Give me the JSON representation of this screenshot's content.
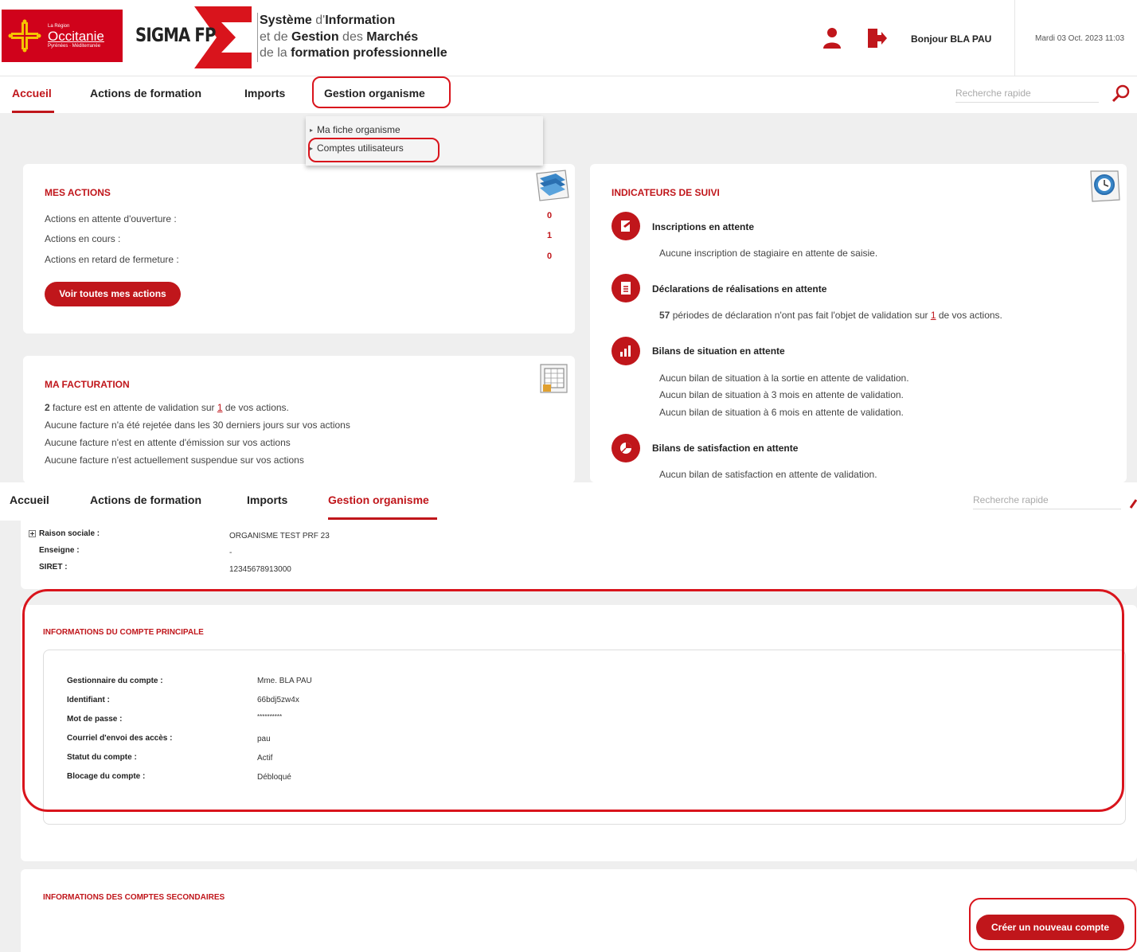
{
  "header": {
    "region_logo": {
      "small_top": "La Région",
      "name": "Occitanie",
      "small_bottom": "Pyrénées · Méditerranée"
    },
    "app_logo": "SIGMA FP",
    "title_lines": [
      {
        "a": "Système",
        "b": " d'",
        "c": "Information"
      },
      {
        "a": "et de ",
        "b": "Gestion",
        "c": " des ",
        "d": "Marchés"
      },
      {
        "a": "de la ",
        "b": "formation professionnelle"
      }
    ],
    "greeting": "Bonjour BLA PAU",
    "date": "Mardi 03 Oct. 2023 11:03",
    "user_icon": "user-icon",
    "logout_icon": "logout-icon"
  },
  "nav": {
    "items": [
      "Accueil",
      "Actions de formation",
      "Imports",
      "Gestion organisme"
    ],
    "search_placeholder": "Recherche rapide",
    "search_icon": "search-icon"
  },
  "dropdown": {
    "items": [
      "Ma fiche organisme",
      "Comptes utilisateurs"
    ]
  },
  "mes_actions": {
    "title": "MES ACTIONS",
    "rows": [
      {
        "label": "Actions en attente d'ouverture :",
        "value": "0"
      },
      {
        "label": "Actions en cours :",
        "value": "1"
      },
      {
        "label": "Actions en retard de fermeture :",
        "value": "0"
      }
    ],
    "button": "Voir toutes mes actions"
  },
  "facturation": {
    "title": "MA FACTURATION",
    "line1_count": "2",
    "line1_mid": " facture est en attente de validation sur ",
    "line1_link": "1",
    "line1_end": " de vos actions.",
    "lines": [
      "Aucune facture n'a été rejetée dans les 30 derniers jours sur vos actions",
      "Aucune facture n'est en attente d'émission sur vos actions",
      "Aucune facture n'est actuellement suspendue sur vos actions"
    ]
  },
  "indicateurs": {
    "title": "INDICATEURS DE SUIVI",
    "inscriptions": {
      "head": "Inscriptions en attente",
      "text": "Aucune inscription de stagiaire en attente de saisie."
    },
    "declarations": {
      "head": "Déclarations de réalisations en attente",
      "count": "57",
      "mid": " périodes de déclaration n'ont pas fait l'objet de validation sur ",
      "link": "1",
      "end": " de vos actions."
    },
    "bilans": {
      "head": "Bilans de situation en attente",
      "lines": [
        "Aucun bilan de situation à la sortie en attente de validation.",
        "Aucun bilan de situation à 3 mois en attente de validation.",
        "Aucun bilan de situation à 6 mois en attente de validation."
      ]
    },
    "satisfaction": {
      "head": "Bilans de satisfaction en attente",
      "text": "Aucun bilan de satisfaction en attente de validation."
    }
  },
  "organisme": {
    "expand_icon": "plus-box-icon",
    "raison_label": "Raison sociale :",
    "raison_value": "ORGANISME TEST PRF 23",
    "enseigne_label": "Enseigne :",
    "enseigne_value": "-",
    "siret_label": "SIRET :",
    "siret_value": "12345678913000"
  },
  "compte_principal": {
    "title": "INFORMATIONS DU COMPTE PRINCIPALE",
    "fields": [
      {
        "label": "Gestionnaire du compte :",
        "value": "Mme. BLA PAU"
      },
      {
        "label": "Identifiant :",
        "value": "66bdj5zw4x"
      },
      {
        "label": "Mot de passe :",
        "value": "**********"
      },
      {
        "label": "Courriel d'envoi des accès :",
        "value": "pau"
      },
      {
        "label": "Statut du compte :",
        "value": "Actif"
      },
      {
        "label": "Blocage du compte :",
        "value": "Débloqué"
      }
    ]
  },
  "comptes_secondaires": {
    "title": "INFORMATIONS DES COMPTES SECONDAIRES",
    "button": "Créer un nouveau compte"
  },
  "colors": {
    "accent": "#c0161b",
    "highlight": "#d9141c"
  }
}
